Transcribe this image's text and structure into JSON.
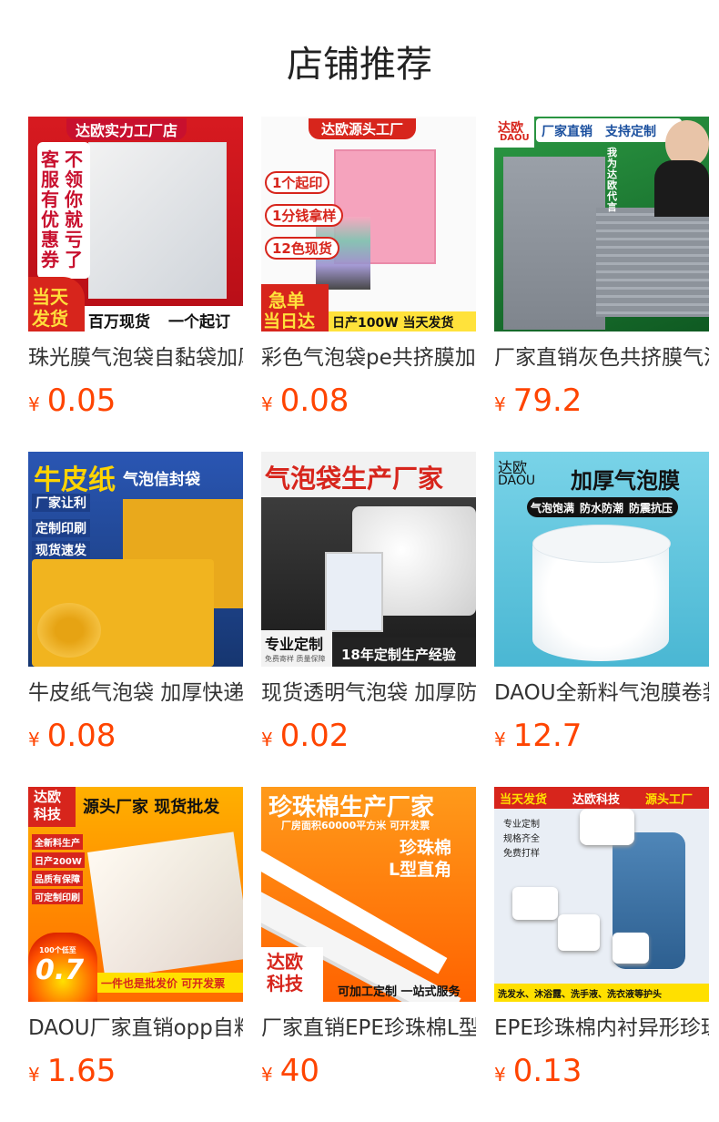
{
  "section_title": "店铺推荐",
  "currency": "¥",
  "products": [
    {
      "name": "珠光膜气泡袋自黏袋加厚",
      "price": "0.05",
      "image_text": {
        "top": "达欧实力工厂店",
        "side1": "客服有优惠券",
        "side2": "不领你就亏了",
        "corner": "当天发货",
        "bottom1": "百万现货",
        "bottom2": "一个起订"
      }
    },
    {
      "name": "彩色气泡袋pe共挤膜加厚",
      "price": "0.08",
      "image_text": {
        "top": "达欧源头工厂",
        "l1": "1个起印",
        "l2": "1分钱拿样",
        "l3": "12色现货",
        "corner1": "急单",
        "corner2": "当日达",
        "bottom": "日产100W 当天发货"
      }
    },
    {
      "name": "厂家直销灰色共挤膜气泡袋",
      "price": "79.2",
      "image_text": {
        "brand1": "达欧",
        "brand2": "DAOU",
        "top1": "厂家直销",
        "top2": "支持定制",
        "side": "我为达欧代言"
      }
    },
    {
      "name": "牛皮纸气泡袋 加厚快递",
      "price": "0.08",
      "image_text": {
        "top1": "牛皮纸",
        "top2": "气泡信封袋",
        "f1": "厂家让利",
        "f2": "定制印刷",
        "f3": "现货速发"
      }
    },
    {
      "name": "现货透明气泡袋 加厚防震",
      "price": "0.02",
      "image_text": {
        "top": "气泡袋生产厂家",
        "corner1": "专业定制",
        "corner2": "免费寄样 质量保障",
        "bottom": "18年定制生产经验"
      }
    },
    {
      "name": "DAOU全新料气泡膜卷装",
      "price": "12.7",
      "image_text": {
        "brand1": "达欧",
        "brand2": "DAOU",
        "title": "加厚气泡膜",
        "f1": "气泡饱满",
        "f2": "防水防潮",
        "f3": "防震抗压"
      }
    },
    {
      "name": "DAOU厂家直销opp自粘袋",
      "price": "1.65",
      "image_text": {
        "brand": "达欧科技",
        "top": "源头厂家 现货批发",
        "f1": "全新料生产",
        "f2": "日产200W",
        "f3": "品质有保障",
        "f4": "可定制印刷",
        "badge": "0.7",
        "badge_small": "100个低至",
        "bottom": "一件也是批发价 可开发票"
      }
    },
    {
      "name": "厂家直销EPE珍珠棉L型直角",
      "price": "40",
      "image_text": {
        "top": "珍珠棉生产厂家",
        "sub": "厂房面积60000平方米 可开发票",
        "t1": "珍珠棉",
        "t2": "L型直角",
        "brand": "达欧科技",
        "bottom": "可加工定制 一站式服务"
      }
    },
    {
      "name": "EPE珍珠棉内衬异形珍珠棉",
      "price": "0.13",
      "image_text": {
        "top1": "当天发货",
        "top2": "达欧科技",
        "top3": "源头工厂",
        "f1": "专业定制",
        "f2": "规格齐全",
        "f3": "免费打样",
        "bottom": "洗发水、沐浴露、洗手液、洗衣液等护头"
      }
    }
  ]
}
